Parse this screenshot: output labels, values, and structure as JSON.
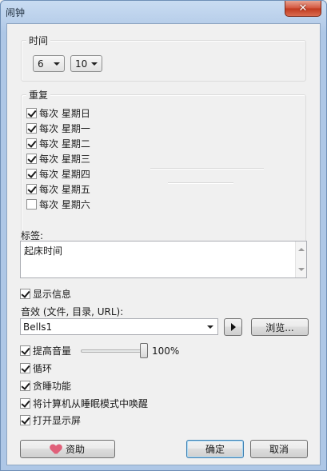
{
  "window": {
    "title": "闹钟",
    "close_glyph": "✕"
  },
  "time_group": {
    "label": "时间",
    "hour": "6",
    "minute": "10"
  },
  "repeat_group": {
    "label": "重复",
    "days": [
      {
        "label": "每次 星期日",
        "checked": true
      },
      {
        "label": "每次 星期一",
        "checked": true
      },
      {
        "label": "每次 星期二",
        "checked": true
      },
      {
        "label": "每次 星期三",
        "checked": true
      },
      {
        "label": "每次 星期四",
        "checked": true
      },
      {
        "label": "每次 星期五",
        "checked": true
      },
      {
        "label": "每次 星期六",
        "checked": false
      }
    ]
  },
  "tag": {
    "label": "标签:",
    "value": "起床时间"
  },
  "show_message": {
    "label": "显示信息",
    "checked": true
  },
  "sound": {
    "label": "音效 (文件, 目录, URL):",
    "value": "Bells1",
    "browse_label": "浏览..."
  },
  "volume": {
    "label": "提高音量",
    "checked": true,
    "value_text": "100%",
    "level": 1.0
  },
  "options": {
    "loop": {
      "label": "循环",
      "checked": true
    },
    "snooze": {
      "label": "贪睡功能",
      "checked": true
    },
    "wake": {
      "label": "将计算机从睡眠模式中唤醒",
      "checked": true
    },
    "display_on": {
      "label": "打开显示屏",
      "checked": true
    }
  },
  "buttons": {
    "donate": "资助",
    "ok": "确定",
    "cancel": "取消"
  },
  "icons": {
    "close": "close-icon",
    "play": "play-icon",
    "heart": "heart-icon",
    "dropdown": "chevron-down-icon"
  }
}
